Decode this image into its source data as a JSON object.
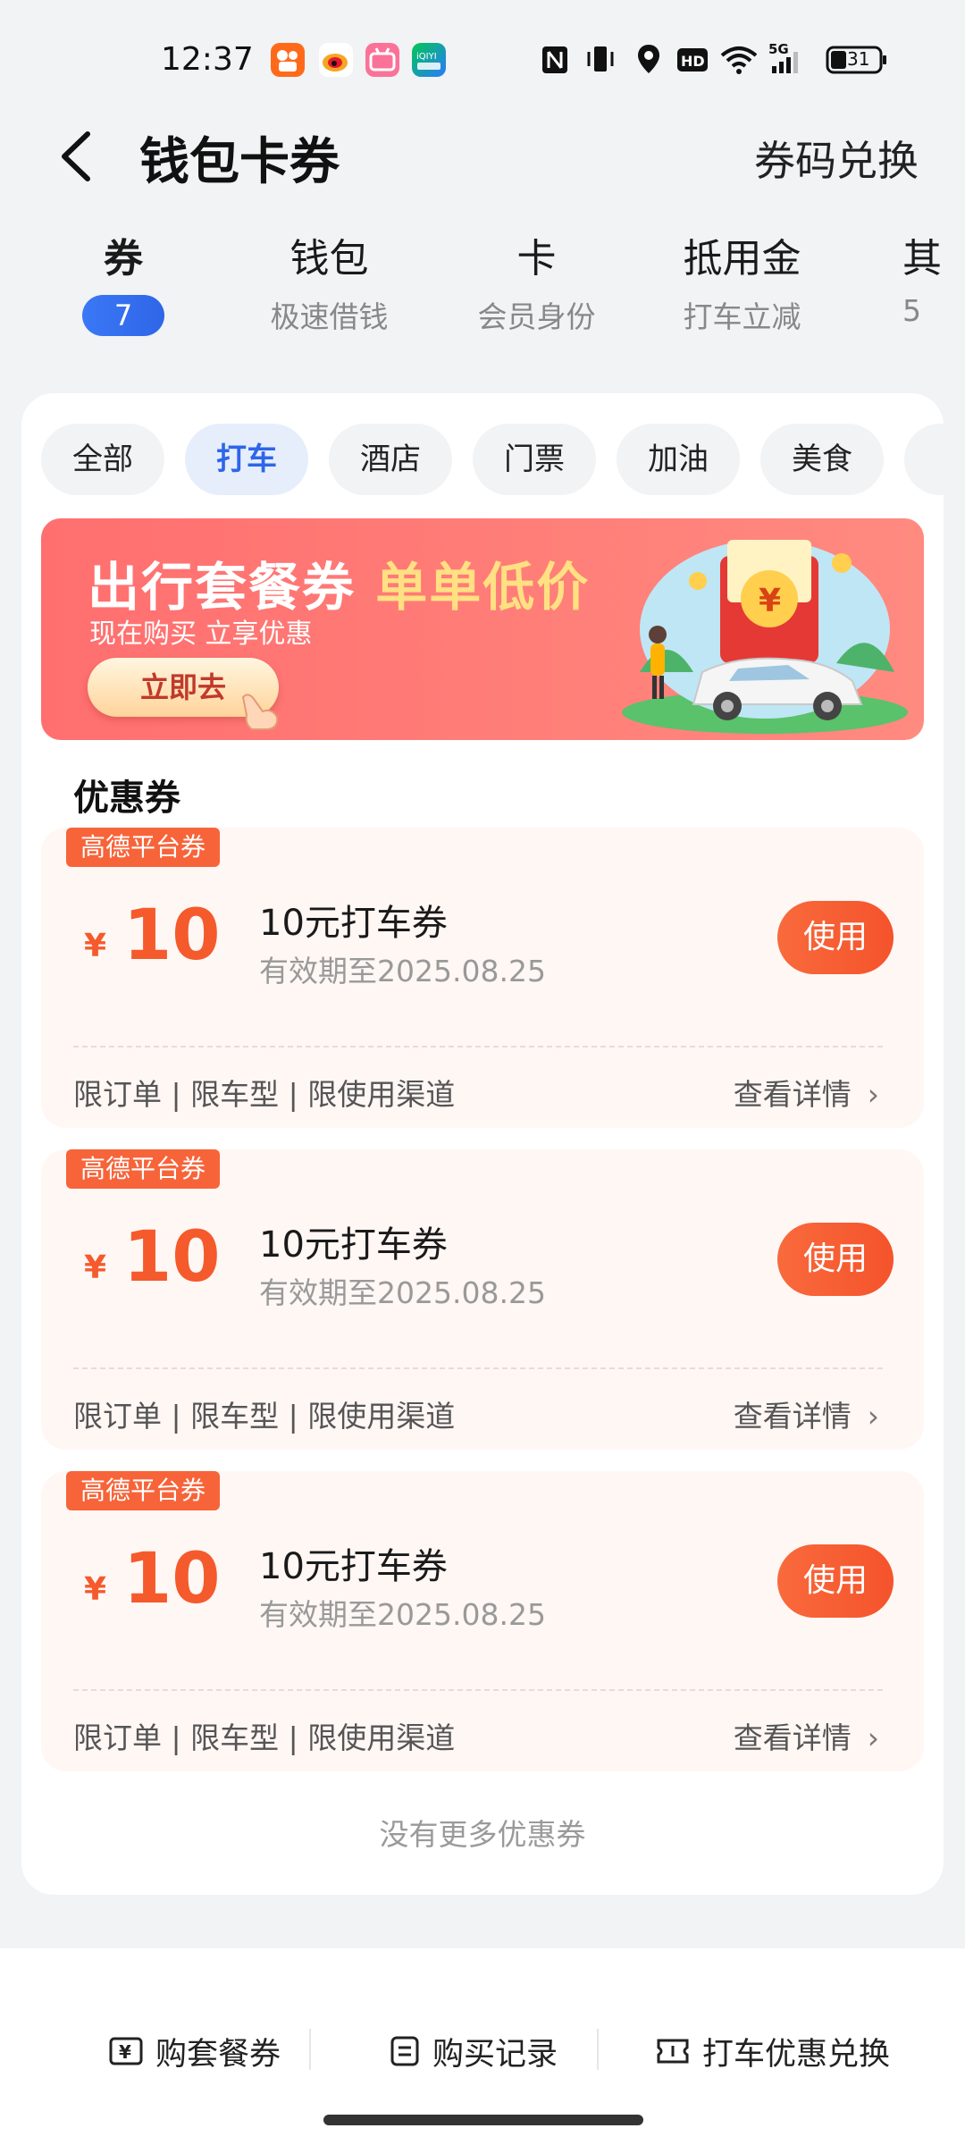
{
  "status": {
    "time": "12:37",
    "battery": "31",
    "network": "5G",
    "apps": [
      "kuaishou-app-icon",
      "weibo-app-icon",
      "bilibili-app-icon",
      "iqiyi-app-icon"
    ]
  },
  "header": {
    "title": "钱包卡券",
    "redeem_label": "券码兑换"
  },
  "categories": [
    {
      "name": "券",
      "badge": "7"
    },
    {
      "name": "钱包",
      "sub": "极速借钱"
    },
    {
      "name": "卡",
      "sub": "会员身份"
    },
    {
      "name": "抵用金",
      "sub": "打车立减"
    },
    {
      "name": "其",
      "sub": "5"
    }
  ],
  "filters": [
    "全部",
    "打车",
    "酒店",
    "门票",
    "加油",
    "美食"
  ],
  "active_filter": "打车",
  "banner": {
    "title_main": "出行套餐券",
    "title_highlight": "单单低价",
    "subtitle": "现在购买 立享优惠",
    "button": "立即去"
  },
  "section_title": "优惠券",
  "coupons": [
    {
      "tag": "高德平台券",
      "currency": "¥",
      "amount": "10",
      "name": "10元打车券",
      "expiry": "有效期至2025.08.25",
      "use": "使用",
      "limits": "限订单 | 限车型 | 限使用渠道",
      "detail": "查看详情"
    },
    {
      "tag": "高德平台券",
      "currency": "¥",
      "amount": "10",
      "name": "10元打车券",
      "expiry": "有效期至2025.08.25",
      "use": "使用",
      "limits": "限订单 | 限车型 | 限使用渠道",
      "detail": "查看详情"
    },
    {
      "tag": "高德平台券",
      "currency": "¥",
      "amount": "10",
      "name": "10元打车券",
      "expiry": "有效期至2025.08.25",
      "use": "使用",
      "limits": "限订单 | 限车型 | 限使用渠道",
      "detail": "查看详情"
    }
  ],
  "no_more": "没有更多优惠券",
  "bottom": {
    "buy_package": "购套餐券",
    "purchase_record": "购买记录",
    "exchange": "打车优惠兑换"
  },
  "colors": {
    "accent_blue": "#2f66e8",
    "coupon_orange": "#f55a2c",
    "banner_red": "#ff6f6f"
  }
}
